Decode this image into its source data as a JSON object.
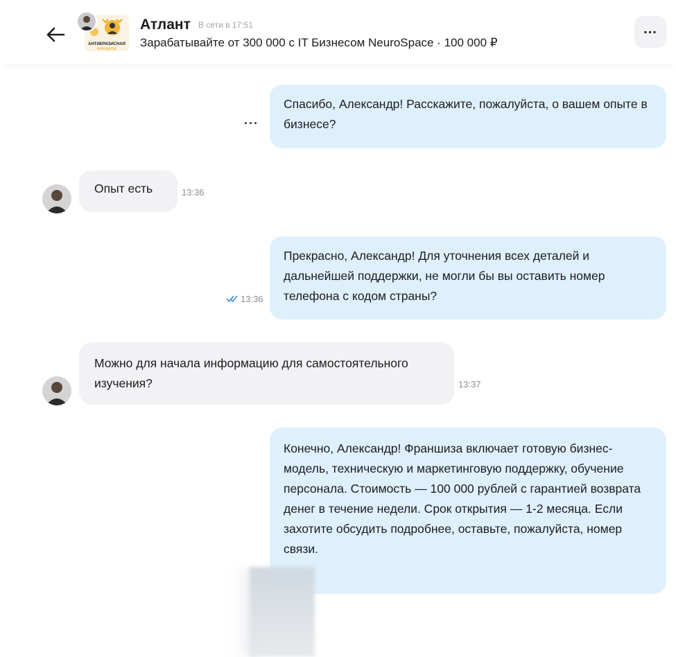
{
  "header": {
    "seller_name": "Атлант",
    "status": "В сети в 17:51",
    "listing": "Зарабатывайте от 300 000 с IT Бизнесом NeuroSpace · 100 000 ₽",
    "thumb_line1": "АНТИКРИЗИСНАЯ",
    "thumb_line2": "ФРАНШИЗА"
  },
  "messages": [
    {
      "direction": "out",
      "text": "Спасибо, Александр! Расскажите, пожалуйста, о вашем опыте в бизнесе?",
      "time": "",
      "status_icon": "typing-dots"
    },
    {
      "direction": "in",
      "text": "Опыт есть",
      "time": "13:36"
    },
    {
      "direction": "out",
      "text": "Прекрасно, Александр! Для уточнения всех деталей и дальнейшей поддержки, не могли бы вы оставить номер телефона с кодом страны?",
      "time": "13:36",
      "status_icon": "double-check-icon"
    },
    {
      "direction": "in",
      "text": "Можно для начала информацию для самостоятельного изучения?",
      "time": "13:37"
    },
    {
      "direction": "out",
      "text": "Конечно, Александр! Франшиза включает готовую бизнес-модель, техническую и маркетинговую поддержку, обучение персонала. Стоимость — 100 000 рублей с гарантией возврата денег в течение недели. Срок открытия — 1-2 месяца. Если захотите обсудить подробнее, оставьте, пожалуйста, номер связи.",
      "time": ""
    }
  ],
  "colors": {
    "outgoing_bubble": "#dff0fd",
    "incoming_bubble": "#f2f2f4",
    "read_check": "#3d8fe8",
    "timestamp": "#8e8e93"
  }
}
